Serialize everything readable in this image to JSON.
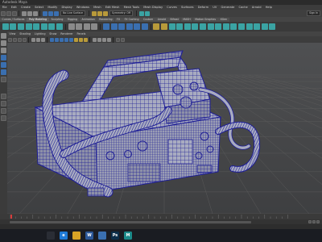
{
  "window": {
    "title": "Autodesk Maya"
  },
  "menus": [
    "File",
    "Edit",
    "Create",
    "Select",
    "Modify",
    "Display",
    "Windows",
    "Mesh",
    "Edit Mesh",
    "Mesh Tools",
    "Mesh Display",
    "Curves",
    "Surfaces",
    "Deform",
    "UV",
    "Generate",
    "Cache",
    "Arnold",
    "Help"
  ],
  "status": {
    "workspace": "No Live Surface",
    "symmetry": "Symmetry: Off",
    "login": "Sign In"
  },
  "shelf_tabs": [
    "Curves / Surfaces",
    "Poly Modeling",
    "Sculpting",
    "Rigging",
    "Animation",
    "Rendering",
    "FX",
    "FX Caching",
    "Custom",
    "Arnold",
    "Bifrost",
    "MASH",
    "Motion Graphics",
    "XGen"
  ],
  "shelf_active": "Poly Modeling",
  "panel_menus": [
    "View",
    "Shading",
    "Lighting",
    "Show",
    "Renderer",
    "Panels"
  ],
  "colors": {
    "mesh_fill": "#a8abc0",
    "wireframe": "#1e1e96",
    "grid": "#5a5a5a",
    "viewport_bg_top": "#4f5052",
    "viewport_bg_bottom": "#3e3f41"
  },
  "taskbar": [
    {
      "icon": "windows-start-icon",
      "label": ""
    },
    {
      "icon": "edge-icon",
      "label": "e"
    },
    {
      "icon": "file-explorer-icon",
      "label": ""
    },
    {
      "icon": "word-icon",
      "label": "W"
    },
    {
      "icon": "photos-icon",
      "label": ""
    },
    {
      "icon": "photoshop-icon",
      "label": "Ps"
    },
    {
      "icon": "maya-icon",
      "label": "M"
    }
  ]
}
